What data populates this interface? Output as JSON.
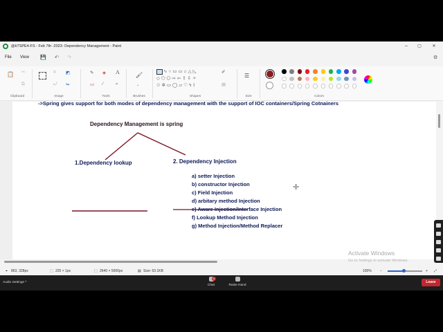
{
  "window": {
    "title": "@kTSPE4-FS - Feb 7th -2023- Dependency Management - Paint",
    "minimize": "–",
    "maximize": "▢",
    "close": "✕"
  },
  "menu": {
    "file": "File",
    "view": "View"
  },
  "ribbon": {
    "groups": {
      "clipboard": "Clipboard",
      "image": "Image",
      "tools": "Tools",
      "brushes": "Brushes",
      "shapes": "Shapes",
      "size": "Size",
      "colors": "Colors"
    },
    "primary_color": "#8b1a1a",
    "palette_row1": [
      "#000000",
      "#7f7f7f",
      "#88001b",
      "#ec1c24",
      "#ff7f27",
      "#ffc90e",
      "#22b14c",
      "#00a8f3",
      "#3f48cc",
      "#a349a4"
    ],
    "palette_row2": [
      "#ffffff",
      "#c3c3c3",
      "#b97a57",
      "#ffaec9",
      "#ffca18",
      "#fdeca6",
      "#b5e61d",
      "#99d9ea",
      "#7092be",
      "#c8bfe7"
    ]
  },
  "canvas": {
    "top_line": "->Spring  gives support for  both modes of dependency  management  with the support  of  IOC containers/Spring Cotnainers",
    "heading": "Dependency Management is spring",
    "branch_left": "1.Dependency lookup",
    "branch_right": "2. Dependency Injection",
    "injection_types": [
      "a) setter Injection",
      "b) constructor Injection",
      "c) Field Injection",
      "d) arbitary method Injection",
      "e) Aware Injection/Interface Injection",
      "f) Lookup Method Injection",
      "g)  Method Injection/Method Replacer"
    ],
    "ink_color": "#7a1020"
  },
  "status": {
    "cursor_pos": "863, 328px",
    "selection": "225 × 1px",
    "canvas_size": "2640 × 5000px",
    "file_size": "Size: 63.1KB",
    "zoom": "100%"
  },
  "watermark": {
    "title": "Activate Windows",
    "subtitle": "Go to Settings to activate Windows."
  },
  "meeting": {
    "audio_settings": "Audio Settings  ^",
    "chat": "Chat",
    "chat_badge": "4",
    "raise_hand": "Raise Hand",
    "leave": "Leave"
  }
}
